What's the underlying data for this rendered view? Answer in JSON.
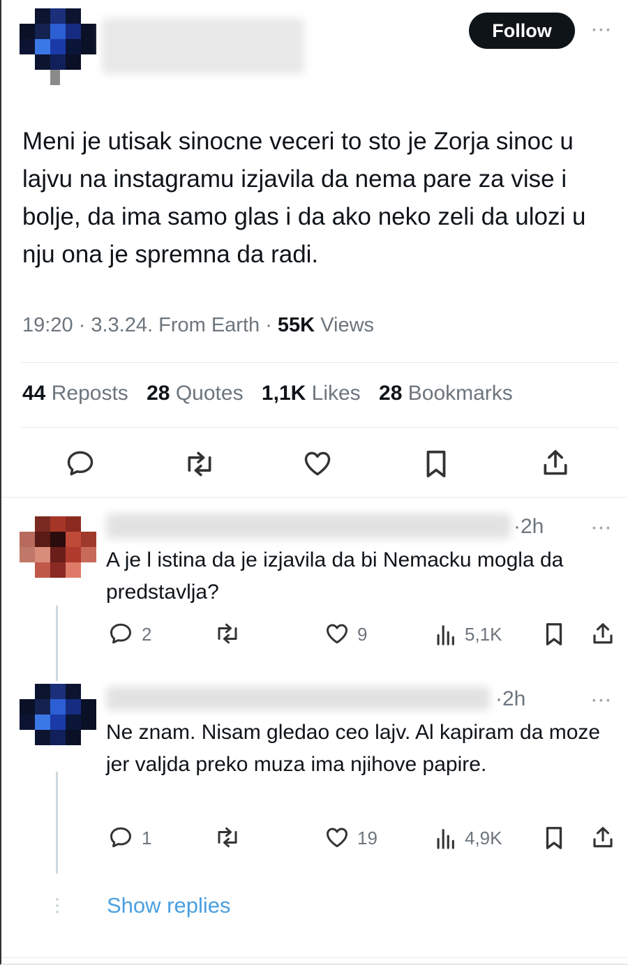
{
  "header": {
    "follow_label": "Follow",
    "more_label": "···"
  },
  "tweet": {
    "text": "Meni je utisak sinocne veceri to sto je Zorja sinoc u lajvu na instagramu izjavila da nema pare za vise i bolje, da ima samo glas i da ako neko zeli da ulozi u nju ona je spremna da radi.",
    "time": "19:20",
    "date": "3.3.24.",
    "source": "From Earth",
    "views_count": "55K",
    "views_label": "Views",
    "reposts_count": "44",
    "reposts_label": "Reposts",
    "quotes_count": "28",
    "quotes_label": "Quotes",
    "likes_count": "1,1K",
    "likes_label": "Likes",
    "bookmarks_count": "28",
    "bookmarks_label": "Bookmarks"
  },
  "replies": [
    {
      "time": "·2h",
      "text": "A je l istina da je izjavila da bi Nemacku mogla da predstavlja?",
      "reply_count": "2",
      "like_count": "9",
      "view_count": "5,1K"
    },
    {
      "time": "·2h",
      "text": "Ne znam. Nisam gledao ceo lajv. Al kapiram da moze jer valjda preko muza ima njihove papire.",
      "reply_count": "1",
      "like_count": "19",
      "view_count": "4,9K"
    }
  ],
  "show_replies_label": "Show replies",
  "icons": [
    "reply-icon",
    "repost-icon",
    "like-icon",
    "bookmark-icon",
    "share-icon",
    "views-icon",
    "more-icon"
  ],
  "colors": {
    "follow_bg": "#0f1419",
    "link": "#4a9fe0",
    "muted": "#6c757d"
  }
}
